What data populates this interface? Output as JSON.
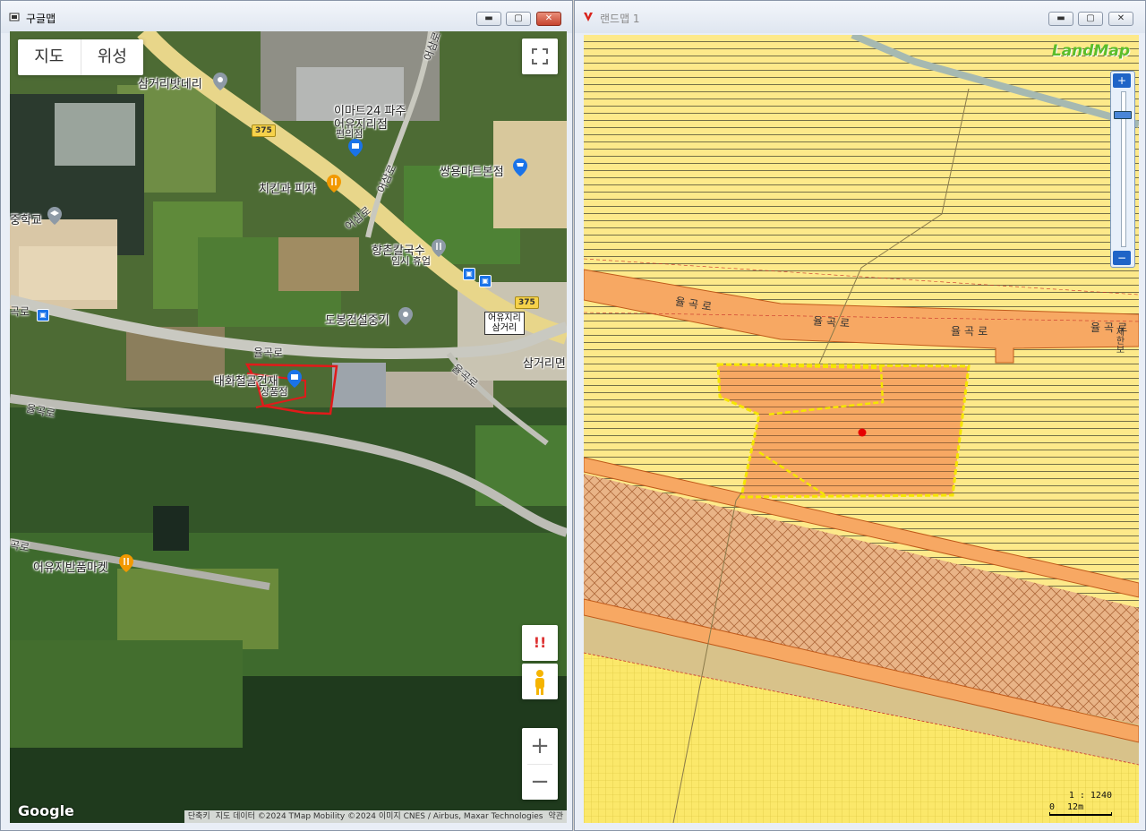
{
  "left_window": {
    "title": "구글맵",
    "map_type": {
      "map": "지도",
      "satellite": "위성"
    },
    "labels": {
      "samgeori_batderi": "삼거리밧데리",
      "emart24_line1": "이마트24 파주",
      "emart24_line2": "어유지리점",
      "convenience": "편의점",
      "chicken_pizza": "치킨과 피자",
      "ssangyong_mart": "쌍용마트본점",
      "middle_school": "중학교",
      "hyangchon": "향촌칼국수",
      "temp_closed": "임시 휴업",
      "dobong": "도봉건설중기",
      "eoyuji_box_line1": "어유지리",
      "eoyuji_box_line2": "삼거리",
      "samgeorimyeon": "삼거리면",
      "taehwa": "태화철골건재",
      "taehwa_sub": "상품점",
      "banpum_market": "어유지반품마켓"
    },
    "roads": {
      "yulgok_main": "율곡로",
      "yulgok_left1": "곡로",
      "yulgok_left2": "율곡로",
      "yulgok_left3": "곡로",
      "yulgok_right": "율곡로",
      "eosam_1": "어삼로",
      "eosam_2": "어삼로",
      "eosam_3": "어삼로"
    },
    "route_shield": "375",
    "attribution": {
      "shortcuts": "단축키",
      "data": "지도 데이터 ©2024 TMap Mobility ©2024 이미지 CNES / Airbus, Maxar Technologies",
      "terms": "약관"
    },
    "warning_symbol": "!!",
    "zoom_in": "+",
    "zoom_out": "−",
    "logo": "Google"
  },
  "right_window": {
    "title": "랜드맵 1",
    "logo": "LandMap",
    "road_label": "율곡로",
    "vertical_text": "제한보",
    "scale_ratio": "1 : 1240",
    "scale_zero": "0",
    "scale_len": "12m",
    "zoom_in": "+",
    "zoom_out": "−"
  },
  "colors": {
    "parcel_outline_left": "#e11a1a",
    "parcel_outline_right": "#f5e600",
    "landmap_base": "#fde98a",
    "road_orange": "#f7a863",
    "window_close": "#c6442e"
  }
}
